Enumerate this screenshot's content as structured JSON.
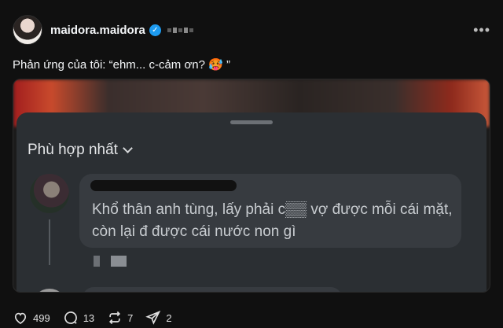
{
  "post": {
    "username": "maidora.maidora",
    "verified_mark": "✓",
    "more_icon": "•••",
    "caption": "Phản ứng của tôi: “ehm... c-cảm ơn? 🥵 ”"
  },
  "screenshot": {
    "sort_label": "Phù hợp nhất",
    "comment_text": "Khổ thân anh tùng, lấy phải c▒▒ vợ được mỗi cái mặt, còn lại đ được cái nước non gì"
  },
  "actions": {
    "likes": "499",
    "comments": "13",
    "reposts": "7",
    "shares": "2"
  },
  "icons": [
    "heart-icon",
    "comment-icon",
    "repost-icon",
    "share-icon",
    "more-icon",
    "verified-icon",
    "chevron-down-icon"
  ],
  "colors": {
    "background": "#101010",
    "verified": "#1d9bf0",
    "sheet": "#2b2f33",
    "bubble": "#373b40"
  }
}
